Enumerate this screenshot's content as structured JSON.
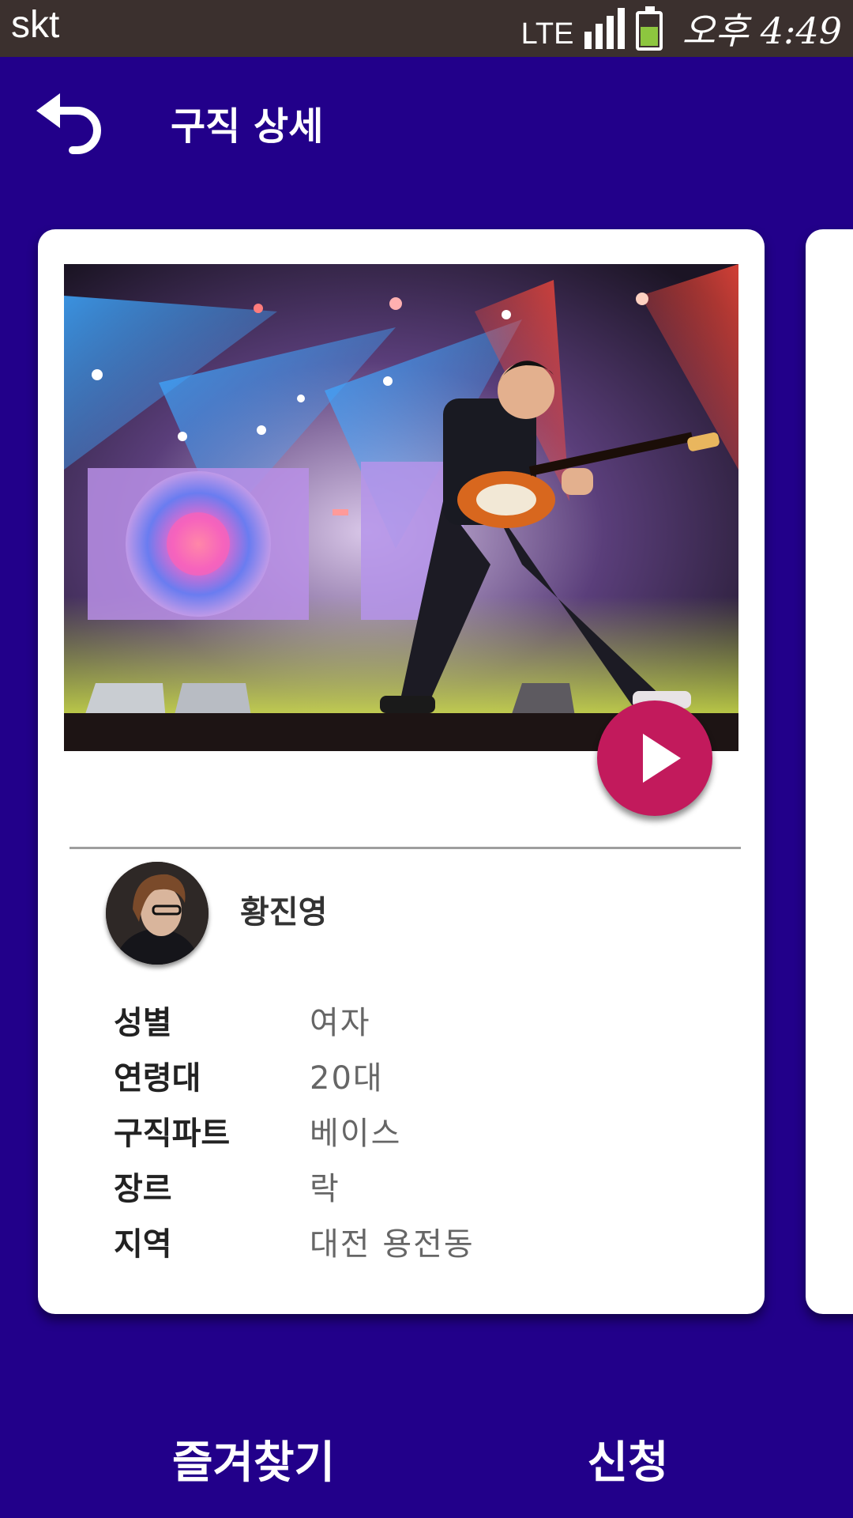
{
  "status_bar": {
    "carrier": "skt",
    "network": "LTE",
    "time": "오후 4:49",
    "icons": [
      "signal-icon",
      "battery-icon"
    ]
  },
  "header": {
    "title": "구직 상세",
    "back_icon": "undo-arrow-icon"
  },
  "card": {
    "media_icon": "play-icon",
    "profile": {
      "name": "황진영"
    },
    "details": [
      {
        "label": "성별",
        "value": "여자"
      },
      {
        "label": "연령대",
        "value": "20대"
      },
      {
        "label": "구직파트",
        "value": "베이스"
      },
      {
        "label": "장르",
        "value": "락"
      },
      {
        "label": "지역",
        "value": "대전 용전동"
      }
    ]
  },
  "actions": {
    "favorite_label": "즐겨찾기",
    "apply_label": "신청"
  },
  "colors": {
    "background": "#22008a",
    "status_bar": "#3b302e",
    "play_button": "#c21a5c",
    "battery": "#8dc63f"
  }
}
